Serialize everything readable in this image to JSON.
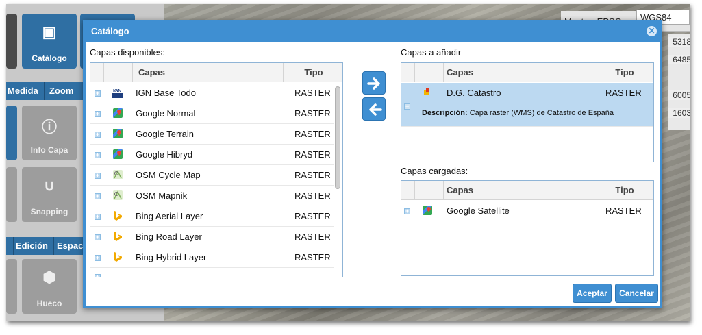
{
  "background": {
    "epsg_label": "Mostrar EPSG:",
    "epsg_value": "WGS84",
    "coords": [
      "5318",
      "6485",
      "6005",
      "1603"
    ],
    "tiles": [
      {
        "label": "Catálogo"
      },
      {
        "label": "Info Capa"
      },
      {
        "label": "Snapping"
      },
      {
        "label": "Hueco"
      }
    ],
    "tabs_row1": [
      "Medida",
      "Zoom"
    ],
    "tabs_row2": [
      "Edición",
      "Espac"
    ]
  },
  "dialog": {
    "title": "Catálogo",
    "available_label": "Capas disponibles:",
    "to_add_label": "Capas a añadir",
    "loaded_label": "Capas cargadas:",
    "col_capas": "Capas",
    "col_tipo": "Tipo",
    "available": [
      {
        "name": "IGN Base Todo",
        "type": "RASTER",
        "icon": "ign-icon"
      },
      {
        "name": "Google Normal",
        "type": "RASTER",
        "icon": "google-maps-icon"
      },
      {
        "name": "Google Terrain",
        "type": "RASTER",
        "icon": "google-maps-icon"
      },
      {
        "name": "Google Hibryd",
        "type": "RASTER",
        "icon": "google-maps-icon"
      },
      {
        "name": "OSM Cycle Map",
        "type": "RASTER",
        "icon": "osm-icon"
      },
      {
        "name": "OSM Mapnik",
        "type": "RASTER",
        "icon": "osm-icon"
      },
      {
        "name": "Bing Aerial Layer",
        "type": "RASTER",
        "icon": "bing-icon"
      },
      {
        "name": "Bing Road Layer",
        "type": "RASTER",
        "icon": "bing-icon"
      },
      {
        "name": "Bing Hybrid Layer",
        "type": "RASTER",
        "icon": "bing-icon"
      }
    ],
    "to_add": [
      {
        "name": "D.G. Catastro",
        "type": "RASTER",
        "icon": "catastro-icon",
        "desc_label": "Descripción:",
        "desc_text": "Capa ráster (WMS) de Catastro de España"
      }
    ],
    "loaded": [
      {
        "name": "Google Satellite",
        "type": "RASTER",
        "icon": "google-maps-icon"
      }
    ],
    "accept_label": "Aceptar",
    "cancel_label": "Cancelar",
    "colors": {
      "accent": "#3f8fd2",
      "selection": "#bcd9f1"
    }
  }
}
